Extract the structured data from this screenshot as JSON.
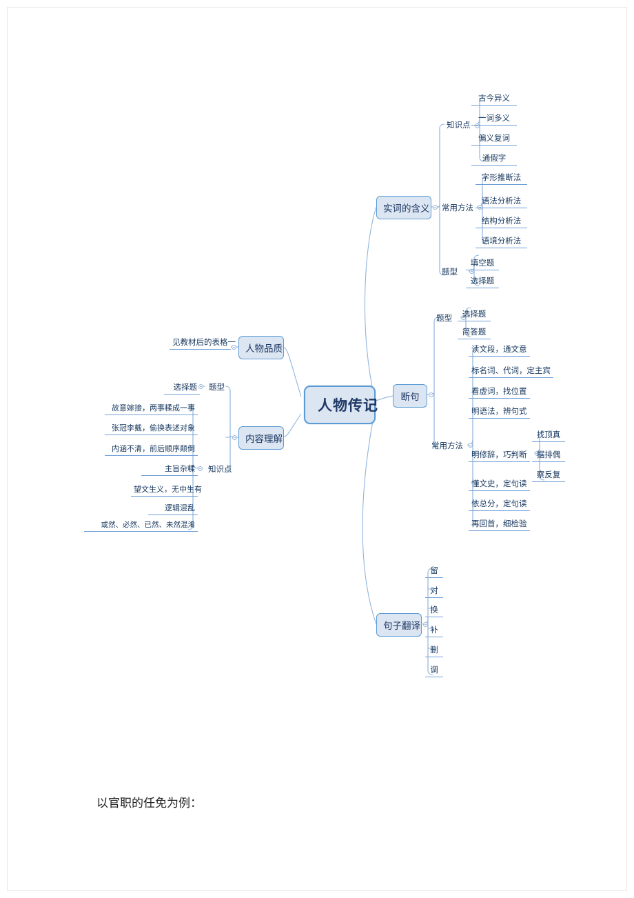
{
  "document": {
    "caption": "以官职的任免为例："
  },
  "mindmap": {
    "root": {
      "label": "人物传记"
    },
    "branches": {
      "shici": {
        "label": "实词的含义",
        "groups": [
          {
            "label": "知识点",
            "items": [
              "古今异义",
              "一词多义",
              "偏义复词",
              "通假字"
            ]
          },
          {
            "label": "常用方法",
            "items": [
              "字形推断法",
              "语法分析法",
              "结构分析法",
              "语境分析法"
            ]
          },
          {
            "label": "题型",
            "items": [
              "填空题",
              "选择题"
            ]
          }
        ]
      },
      "duanju": {
        "label": "断句",
        "groups": [
          {
            "label": "题型",
            "items": [
              "选择题",
              "简答题"
            ]
          },
          {
            "label": "常用方法",
            "items": [
              "读文段，通文意",
              "标名词、代词，定主宾",
              "看虚词，找位置",
              "明语法，辨句式",
              "明修辞，巧判断",
              "懂文史，定句读",
              "依总分，定句读",
              "再回首，细检验"
            ],
            "sub": {
              "parent": "明修辞，巧判断",
              "items": [
                "找顶真",
                "据排偶",
                "察反复"
              ]
            }
          }
        ]
      },
      "fanyi": {
        "label": "句子翻译",
        "items": [
          "留",
          "对",
          "换",
          "补",
          "删",
          "调"
        ]
      },
      "renwu": {
        "label": "人物品质",
        "items": [
          "见教材后的表格一"
        ]
      },
      "neirong": {
        "label": "内容理解",
        "groups": [
          {
            "label": "题型",
            "items": [
              "选择题"
            ]
          },
          {
            "label": "知识点",
            "items": [
              "故意嫁接，两事糅成一事",
              "张冠李戴，偷换表述对象",
              "内涵不清，前后顺序颠倒",
              "主旨杂糅",
              "望文生义，无中生有",
              "逻辑混乱",
              "或然、必然、已然、未然混淆"
            ]
          }
        ]
      }
    }
  },
  "colors": {
    "node_fill": "#dce6f2",
    "node_border": "#5b9bd5",
    "line": "#6f9fd8",
    "text": "#17375e"
  }
}
